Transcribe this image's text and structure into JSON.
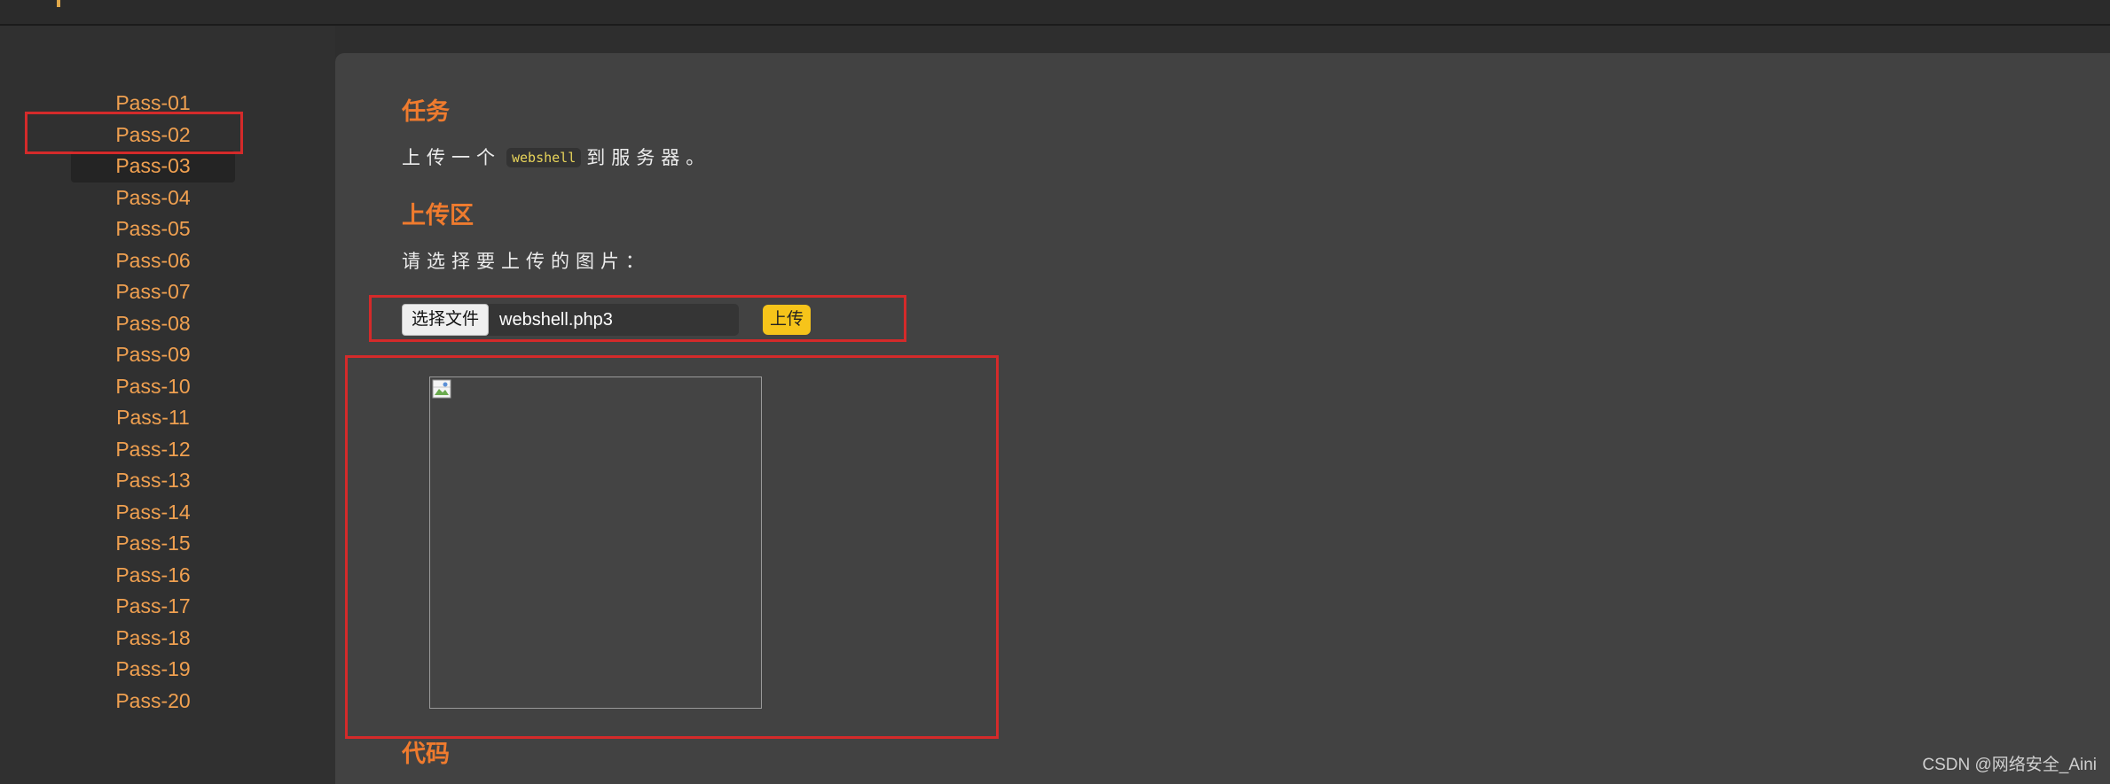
{
  "sidebar": {
    "items": [
      {
        "label": "Pass-01"
      },
      {
        "label": "Pass-02"
      },
      {
        "label": "Pass-03"
      },
      {
        "label": "Pass-04"
      },
      {
        "label": "Pass-05"
      },
      {
        "label": "Pass-06"
      },
      {
        "label": "Pass-07"
      },
      {
        "label": "Pass-08"
      },
      {
        "label": "Pass-09"
      },
      {
        "label": "Pass-10"
      },
      {
        "label": "Pass-11"
      },
      {
        "label": "Pass-12"
      },
      {
        "label": "Pass-13"
      },
      {
        "label": "Pass-14"
      },
      {
        "label": "Pass-15"
      },
      {
        "label": "Pass-16"
      },
      {
        "label": "Pass-17"
      },
      {
        "label": "Pass-18"
      },
      {
        "label": "Pass-19"
      },
      {
        "label": "Pass-20"
      }
    ],
    "active": "Pass-03"
  },
  "main": {
    "task_heading": "任务",
    "task_text_before": "上传一个",
    "task_code": "webshell",
    "task_text_after": "到服务器。",
    "upload_heading": "上传区",
    "upload_prompt": "请选择要上传的图片：",
    "file_button_label": "选择文件",
    "file_name": "webshell.php3",
    "upload_button_label": "上传",
    "code_heading": "代码"
  },
  "watermark": "CSDN @网络安全_Aini",
  "colors": {
    "accent_orange": "#ef7b2e",
    "link_orange": "#f0a050",
    "upload_yellow": "#f6c41a",
    "highlight_red": "#d42a2a",
    "panel_bg": "#424242",
    "sidebar_bg": "#303030"
  },
  "icons": {
    "broken_image": "broken-image-icon"
  }
}
